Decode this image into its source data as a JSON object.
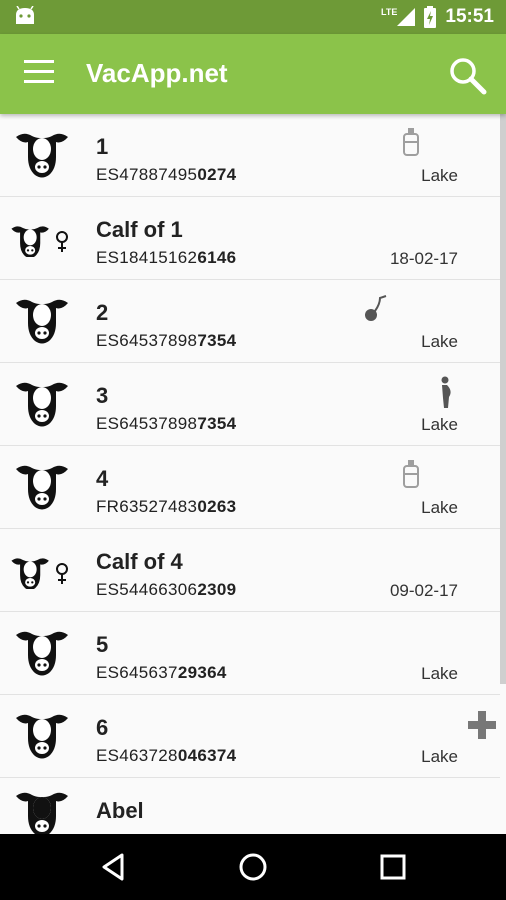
{
  "status_bar": {
    "network": "LTE",
    "time": "15:51"
  },
  "app_bar": {
    "title": "VacApp.net"
  },
  "animals": [
    {
      "name": "1",
      "code_prefix": "ES47887495",
      "code_suffix": "0274",
      "right_text": "Lake",
      "type": "cow",
      "status_icon": "baby-bottle-icon"
    },
    {
      "name": "Calf of 1",
      "code_prefix": "ES18415162",
      "code_suffix": "6146",
      "right_text": "18-02-17",
      "type": "calf-female",
      "status_icon": ""
    },
    {
      "name": "2",
      "code_prefix": "ES64537898",
      "code_suffix": "7354",
      "right_text": "Lake",
      "type": "cow",
      "status_icon": "insemination-icon"
    },
    {
      "name": "3",
      "code_prefix": "ES64537898",
      "code_suffix": "7354",
      "right_text": "Lake",
      "type": "cow",
      "status_icon": "pregnant-icon"
    },
    {
      "name": "4",
      "code_prefix": "FR63527483",
      "code_suffix": "0263",
      "right_text": "Lake",
      "type": "cow",
      "status_icon": "baby-bottle-icon"
    },
    {
      "name": "Calf of 4",
      "code_prefix": "ES54466306",
      "code_suffix": "2309",
      "right_text": "09-02-17",
      "type": "calf-female",
      "status_icon": ""
    },
    {
      "name": "5",
      "code_prefix": "ES645637",
      "code_suffix": "29364",
      "right_text": "Lake",
      "type": "cow",
      "status_icon": ""
    },
    {
      "name": "6",
      "code_prefix": "ES463728",
      "code_suffix": "046374",
      "right_text": "Lake",
      "type": "cow",
      "status_icon": "plus-icon"
    },
    {
      "name": "Abel",
      "code_prefix": "",
      "code_suffix": "",
      "right_text": "",
      "type": "bull",
      "status_icon": ""
    }
  ],
  "colors": {
    "primary": "#8bc34a",
    "primary_dark": "#6e9a37",
    "navbar": "#000000"
  },
  "icons": {
    "menu": "hamburger-icon",
    "search": "search-icon",
    "nav_back": "back-icon",
    "nav_home": "home-icon",
    "nav_recents": "recents-icon"
  }
}
